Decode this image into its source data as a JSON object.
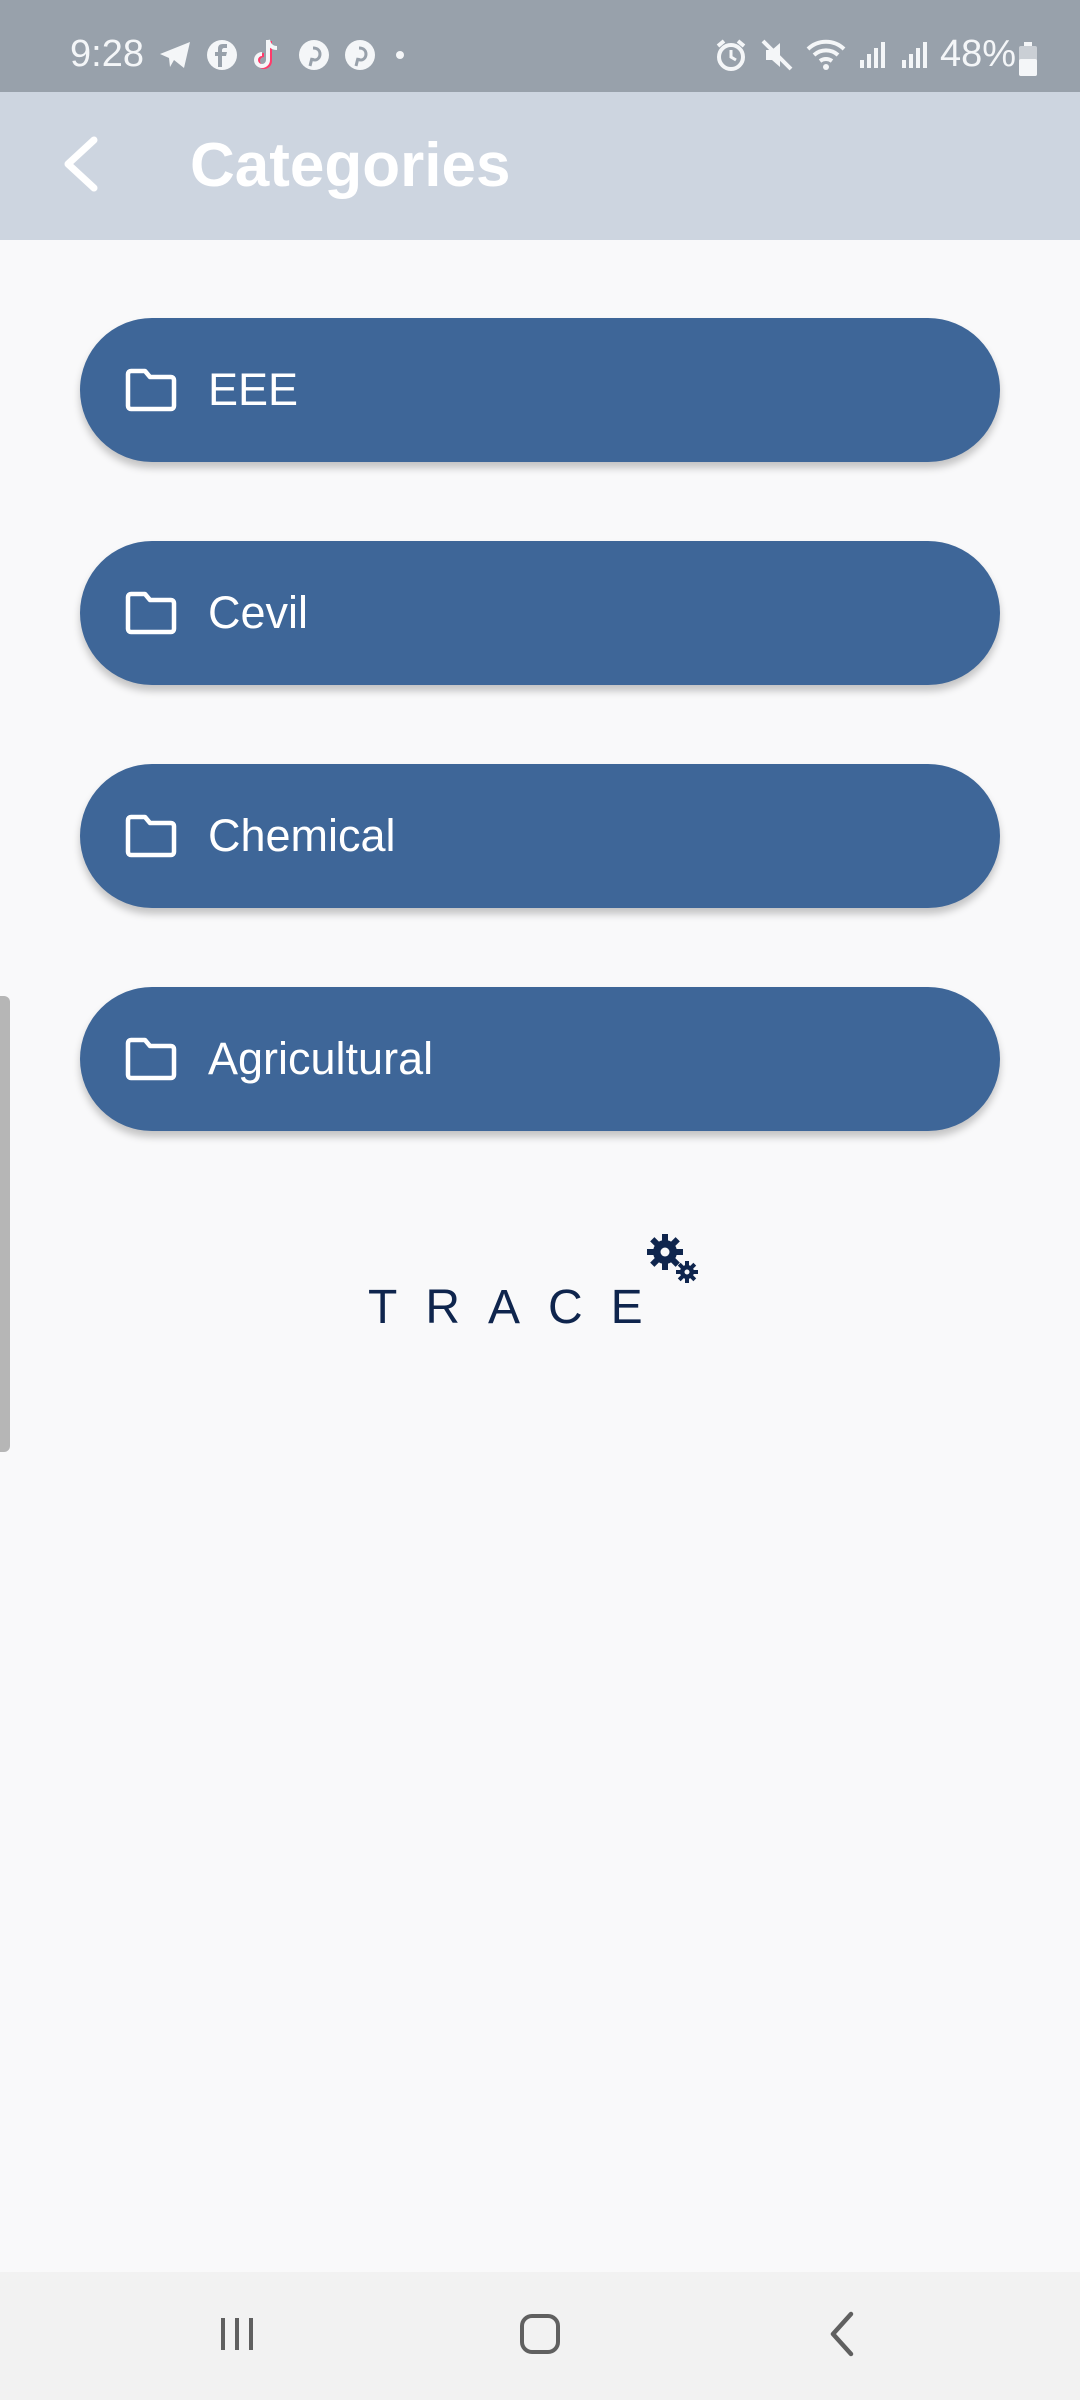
{
  "status_bar": {
    "time": "9:28",
    "battery": "48%",
    "left_icons": [
      "telegram-icon",
      "facebook-icon",
      "tiktok-icon",
      "pinterest-icon",
      "pinterest-icon",
      "dot-icon"
    ],
    "right_icons": [
      "alarm-icon",
      "mute-icon",
      "wifi-icon",
      "signal-icon",
      "signal-icon",
      "battery-icon"
    ]
  },
  "app_bar": {
    "title": "Categories",
    "back_icon": "arrow-back-icon"
  },
  "categories": [
    {
      "label": "EEE",
      "icon": "folder-icon"
    },
    {
      "label": "Cevil",
      "icon": "folder-icon"
    },
    {
      "label": "Chemical",
      "icon": "folder-icon"
    },
    {
      "label": "Agricultural",
      "icon": "folder-icon"
    }
  ],
  "logo": {
    "text": "TRACE",
    "icon": "gears-icon"
  },
  "nav_bar": {
    "items": [
      "recents-icon",
      "home-icon",
      "back-icon"
    ]
  },
  "colors": {
    "status_bar_bg": "#98a1ab",
    "app_bar_bg": "#cdd5e0",
    "button_bg": "#3e6698",
    "logo_color": "#0f254d",
    "page_bg": "#f9f9fa"
  }
}
